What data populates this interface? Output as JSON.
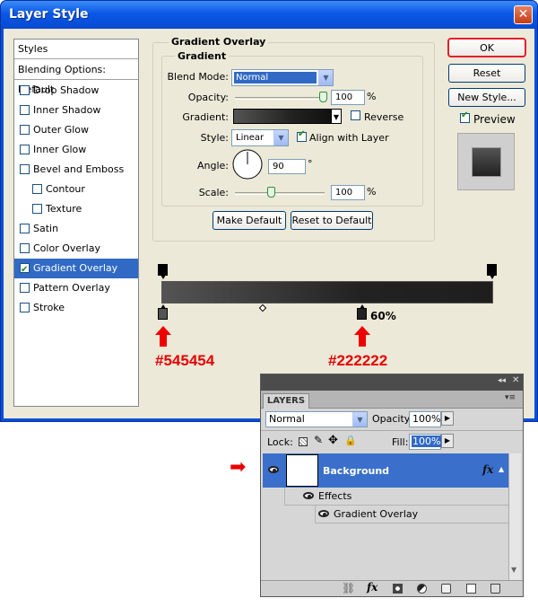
{
  "dialog": {
    "title": "Layer Style",
    "close_glyph": "✕",
    "ok_label": "OK",
    "reset_label": "Reset",
    "new_style_label": "New Style...",
    "preview_label": "Preview",
    "preview_checked": true
  },
  "styles_list": {
    "header": "Styles",
    "blending": "Blending Options: Default",
    "items": [
      {
        "label": "Drop Shadow",
        "checked": false,
        "indent": false,
        "selected": false
      },
      {
        "label": "Inner Shadow",
        "checked": false,
        "indent": false,
        "selected": false
      },
      {
        "label": "Outer Glow",
        "checked": false,
        "indent": false,
        "selected": false
      },
      {
        "label": "Inner Glow",
        "checked": false,
        "indent": false,
        "selected": false
      },
      {
        "label": "Bevel and Emboss",
        "checked": false,
        "indent": false,
        "selected": false
      },
      {
        "label": "Contour",
        "checked": false,
        "indent": true,
        "selected": false
      },
      {
        "label": "Texture",
        "checked": false,
        "indent": true,
        "selected": false
      },
      {
        "label": "Satin",
        "checked": false,
        "indent": false,
        "selected": false
      },
      {
        "label": "Color Overlay",
        "checked": false,
        "indent": false,
        "selected": false
      },
      {
        "label": "Gradient Overlay",
        "checked": true,
        "indent": false,
        "selected": true
      },
      {
        "label": "Pattern Overlay",
        "checked": false,
        "indent": false,
        "selected": false
      },
      {
        "label": "Stroke",
        "checked": false,
        "indent": false,
        "selected": false
      }
    ]
  },
  "gradient_overlay": {
    "group_title": "Gradient Overlay",
    "sub_group_title": "Gradient",
    "blend_mode_label": "Blend Mode:",
    "blend_mode_value": "Normal",
    "opacity_label": "Opacity:",
    "opacity_value": "100",
    "opacity_unit": "%",
    "opacity_level": 1.0,
    "gradient_label": "Gradient:",
    "reverse_label": "Reverse",
    "reverse_checked": false,
    "style_label": "Style:",
    "style_value": "Linear",
    "align_label": "Align with Layer",
    "align_checked": true,
    "angle_label": "Angle:",
    "angle_value": "90",
    "angle_unit": "°",
    "scale_label": "Scale:",
    "scale_value": "100",
    "scale_unit": "%",
    "scale_level": 0.4,
    "make_default_label": "Make Default",
    "reset_default_label": "Reset to Default"
  },
  "gradient_editor": {
    "stop_location_label": "60%",
    "stop1_hex": "#545454",
    "stop2_hex": "#222222",
    "colors": {
      "stop1": "#545454",
      "stop2": "#222222",
      "arrow": "#ee0000"
    }
  },
  "layers_panel": {
    "tab_label": "LAYERS",
    "blend_mode_value": "Normal",
    "opacity_label": "Opacity:",
    "opacity_value": "100%",
    "lock_label": "Lock:",
    "fill_label": "Fill:",
    "fill_value": "100%",
    "layer_name": "Background",
    "fx_glyph": "fx",
    "effects_label": "Effects",
    "effect_item": "Gradient Overlay",
    "arrow_glyph": "➡",
    "colors": {
      "selected_row": "#3a6fcb"
    }
  }
}
